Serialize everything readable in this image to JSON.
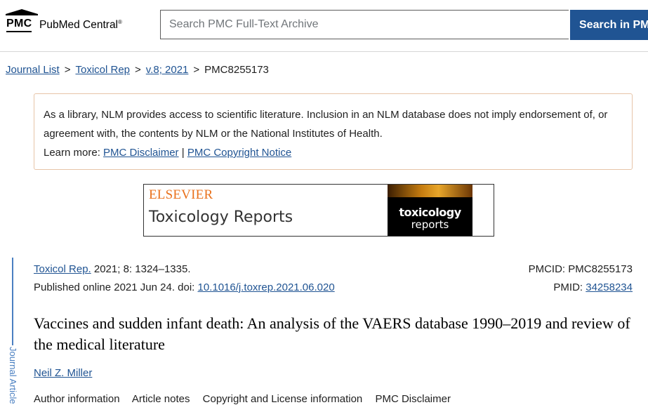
{
  "header": {
    "logo_short": "PMC",
    "logo_name": "PubMed Central",
    "logo_reg": "®",
    "search_placeholder": "Search PMC Full-Text Archive",
    "search_button": "Search in PMC"
  },
  "breadcrumb": {
    "items": [
      "Journal List",
      "Toxicol Rep",
      "v.8; 2021"
    ],
    "current": "PMC8255173",
    "separator": ">"
  },
  "disclaimer": {
    "text": "As a library, NLM provides access to scientific literature. Inclusion in an NLM database does not imply endorsement of, or agreement with, the contents by NLM or the National Institutes of Health.",
    "learn_more": "Learn more:",
    "link1": "PMC Disclaimer",
    "divider": "|",
    "link2": "PMC Copyright Notice"
  },
  "banner": {
    "publisher": "ELSEVIER",
    "journal": "Toxicology Reports",
    "cover_title": "toxicology",
    "cover_sub": "reports"
  },
  "side_tab": {
    "label": "Journal Article"
  },
  "citation": {
    "journal_link": "Toxicol Rep.",
    "volume": "2021; 8: 1324–1335.",
    "published_label": "Published online 2021 Jun 24. doi:",
    "doi": "10.1016/j.toxrep.2021.06.020",
    "pmcid": "PMCID: PMC8255173",
    "pmid_label": "PMID:",
    "pmid": "34258234"
  },
  "article": {
    "title": "Vaccines and sudden infant death: An analysis of the VAERS database 1990–2019 and review of the medical literature",
    "author": "Neil Z. Miller"
  },
  "info_links": [
    "Author information",
    "Article notes",
    "Copyright and License information",
    "PMC Disclaimer"
  ],
  "colors": {
    "link": "#205493",
    "search_button_bg": "#205493",
    "disclaimer_border": "#e7c4a8",
    "publisher_orange": "#e9711c",
    "side_tab": "#4a7fc1"
  }
}
